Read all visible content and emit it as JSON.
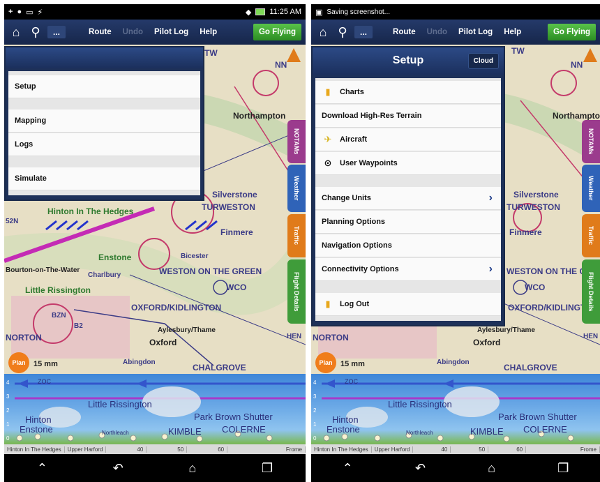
{
  "left": {
    "status": {
      "time": "11:25 AM",
      "notification": ""
    },
    "toolbar": {
      "route": "Route",
      "undo": "Undo",
      "pilot_log": "Pilot Log",
      "help": "Help",
      "go_flying": "Go Flying",
      "more": "..."
    },
    "menu": {
      "items": [
        "Setup",
        "Mapping",
        "Logs",
        "Simulate"
      ]
    }
  },
  "right": {
    "status": {
      "notification": "Saving screenshot..."
    },
    "toolbar": {
      "route": "Route",
      "undo": "Undo",
      "pilot_log": "Pilot Log",
      "help": "Help",
      "go_flying": "Go Flying",
      "more": "..."
    },
    "setup": {
      "title": "Setup",
      "cloud": "Cloud",
      "items": [
        {
          "label": "Charts",
          "icon": "charts-icon"
        },
        {
          "label": "Download High-Res Terrain",
          "icon": ""
        },
        {
          "label": "Aircraft",
          "icon": "aircraft-icon"
        },
        {
          "label": "User Waypoints",
          "icon": "waypoint-icon"
        },
        {
          "label": "Change Units",
          "chevron": true
        },
        {
          "label": "Planning Options"
        },
        {
          "label": "Navigation Options"
        },
        {
          "label": "Connectivity Options",
          "chevron": true
        },
        {
          "label": "Log Out",
          "icon": "logout-icon"
        }
      ]
    }
  },
  "map": {
    "labels": {
      "northampton": "Northampton",
      "silverstone": "Silverstone",
      "turweston": "TURWESTON",
      "finmere": "Finmere",
      "hinton": "Hinton In The Hedges",
      "enstone": "Enstone",
      "bicester": "Bicester",
      "weston": "WESTON ON THE GREEN",
      "wco": "WCO",
      "little_rissington": "Little Rissington",
      "kidlington": "OXFORD/KIDLINGTON",
      "aylesbury": "Aylesbury/Thame",
      "oxford": "Oxford",
      "abingdon": "Abingdon",
      "chalgrove": "CHALGROVE",
      "norton": "NORTON",
      "bourton": "Bourton-on-The-Water",
      "charlbury": "Charlbury",
      "bzn": "BZN",
      "b2": "B2",
      "tw": "TW",
      "nn": "NN",
      "s2n": "52N",
      "hen": "HEN",
      "scale": "15 mm"
    },
    "tabs": [
      "NOTAMs",
      "Weather",
      "Traffic",
      "Flight Details"
    ],
    "orange_btn": "Plan"
  },
  "profile": {
    "labels": {
      "rissington": "Little Rissington",
      "hinton": "Hinton",
      "enstone": "Enstone",
      "park": "Park Brown Shutter",
      "colerne": "COLERNE",
      "kimble": "KIMBLE",
      "northleach": "Northleach",
      "zoc": "ZOC"
    },
    "yaxis": [
      "4",
      "3",
      "2",
      "1",
      "0"
    ],
    "xaxis": [
      "Hinton In The Hedges",
      "Upper Harford",
      "40",
      "50",
      "60",
      "Frome"
    ]
  },
  "colors": {
    "toolbar": "#1e3159",
    "go_flying": "#3aa32e",
    "route_line": "#c42bb5"
  }
}
